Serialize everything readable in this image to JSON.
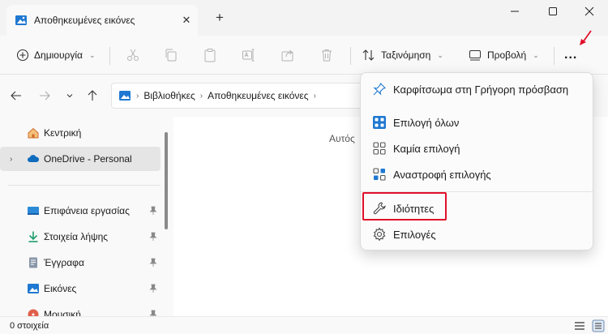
{
  "window": {
    "tab_title": "Αποθηκευμένες εικόνες",
    "new_tab_label": "+"
  },
  "command_bar": {
    "new_label": "Δημιουργία",
    "sort_label": "Ταξινόμηση",
    "view_label": "Προβολή",
    "more_label": "..."
  },
  "address": {
    "crumbs": [
      "Βιβλιοθήκες",
      "Αποθηκευμένες εικόνες"
    ]
  },
  "nav": {
    "items": [
      {
        "label": "Κεντρική"
      },
      {
        "label": "OneDrive - Personal"
      },
      {
        "label": "Επιφάνεια εργασίας"
      },
      {
        "label": "Στοιχεία λήψης"
      },
      {
        "label": "Έγγραφα"
      },
      {
        "label": "Εικόνες"
      },
      {
        "label": "Μουσική"
      }
    ]
  },
  "content": {
    "column_header_partial": "Αυτός"
  },
  "status": {
    "items_count": "0 στοιχεία"
  },
  "menu": {
    "items": [
      {
        "label": "Καρφίτσωμα στη Γρήγορη πρόσβαση",
        "icon": "pin-icon"
      },
      {
        "label": "Επιλογή όλων",
        "icon": "select-all-icon"
      },
      {
        "label": "Καμία επιλογή",
        "icon": "select-none-icon"
      },
      {
        "label": "Αναστροφή επιλογής",
        "icon": "invert-selection-icon"
      },
      {
        "label": "Ιδιότητες",
        "icon": "wrench-icon"
      },
      {
        "label": "Επιλογές",
        "icon": "gear-icon"
      }
    ]
  },
  "colors": {
    "accent": "#0067c0",
    "highlight": "#e0102a"
  }
}
